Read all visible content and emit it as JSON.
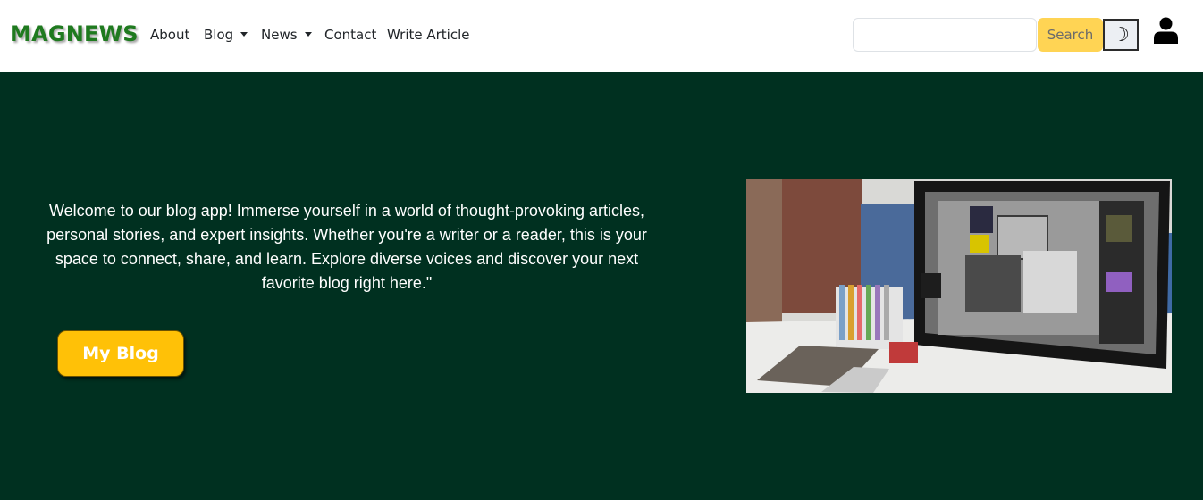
{
  "navbar": {
    "brand": "MAGNEWS",
    "links": {
      "about": "About",
      "blog": "Blog",
      "news": "News",
      "contact": "Contact",
      "write_article": "Write Article"
    },
    "search": {
      "value": "",
      "placeholder": "",
      "button_label": "Search"
    },
    "theme_toggle": {
      "icon": "moon-icon",
      "glyph": "☽"
    },
    "user": {
      "icon": "user-icon"
    }
  },
  "hero": {
    "text": "Welcome to our blog app! Immerse yourself in a world of thought-provoking articles, personal stories, and expert insights. Whether you're a writer or a reader, this is your space to connect, share, and learn. Explore diverse voices and discover your next favorite blog right here.\"",
    "button_label": "My Blog",
    "image": "workspace-desk-photo"
  },
  "colors": {
    "brand": "#1f7a1f",
    "hero_bg": "#003020",
    "accent_yellow": "#ffc107",
    "search_button": "#ffd454"
  }
}
